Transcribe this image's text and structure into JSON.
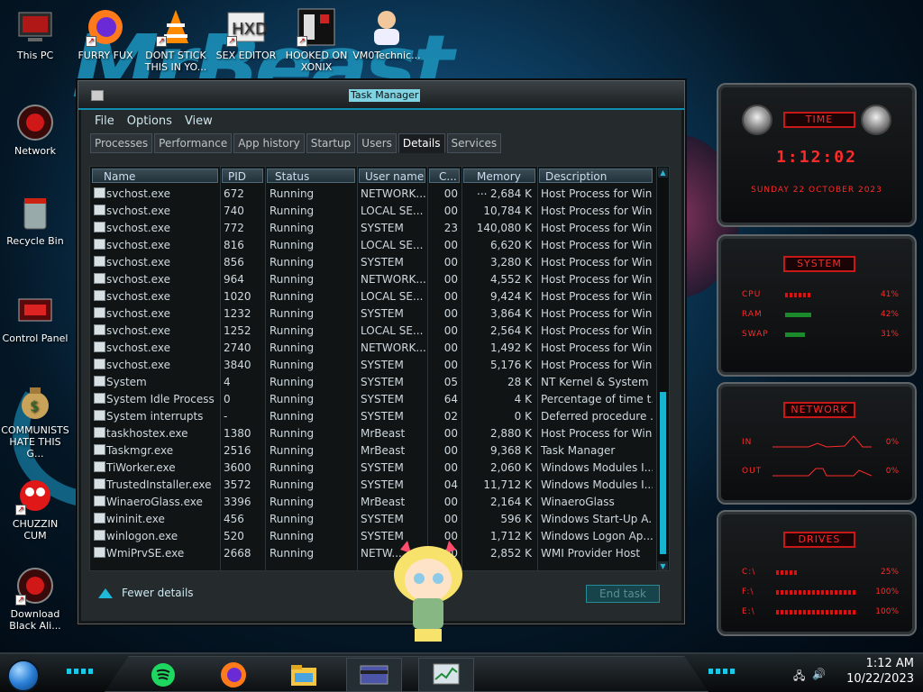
{
  "desktop": {
    "wallpaper_text": "MrBeast",
    "icons": [
      {
        "label": "This PC",
        "icon": "computer-icon"
      },
      {
        "label": "FURRY FUX",
        "icon": "firefox-icon"
      },
      {
        "label": "DONT STICK THIS IN YO...",
        "icon": "vlc-icon"
      },
      {
        "label": "SEX EDITOR",
        "icon": "hxd-icon"
      },
      {
        "label": "HOOKED ON XONIX",
        "icon": "xonix-icon"
      },
      {
        "label": "VM0Technic...",
        "icon": "doctor-icon"
      },
      {
        "label": "Network",
        "icon": "network-icon"
      },
      {
        "label": "Recycle Bin",
        "icon": "recycle-bin-icon"
      },
      {
        "label": "Control Panel",
        "icon": "control-panel-icon"
      },
      {
        "label": "COMMUNISTS HATE THIS G...",
        "icon": "money-bag-icon"
      },
      {
        "label": "CHUZZIN CUM",
        "icon": "chuzzle-icon"
      },
      {
        "label": "Download Black Ali...",
        "icon": "alien-icon"
      }
    ]
  },
  "taskmanager": {
    "title": "Task Manager",
    "menu": [
      "File",
      "Options",
      "View"
    ],
    "tabs": [
      "Processes",
      "Performance",
      "App history",
      "Startup",
      "Users",
      "Details",
      "Services"
    ],
    "active_tab": "Details",
    "columns": [
      "Name",
      "PID",
      "Status",
      "User name",
      "C...",
      "Memory ...",
      "Description"
    ],
    "rows": [
      {
        "name": "svchost.exe",
        "pid": "672",
        "status": "Running",
        "user": "NETWORK...",
        "cpu": "00",
        "mem": "2,684 K",
        "desc": "Host Process for Win..."
      },
      {
        "name": "svchost.exe",
        "pid": "740",
        "status": "Running",
        "user": "LOCAL SE...",
        "cpu": "00",
        "mem": "10,784 K",
        "desc": "Host Process for Win..."
      },
      {
        "name": "svchost.exe",
        "pid": "772",
        "status": "Running",
        "user": "SYSTEM",
        "cpu": "23",
        "mem": "140,080 K",
        "desc": "Host Process for Win..."
      },
      {
        "name": "svchost.exe",
        "pid": "816",
        "status": "Running",
        "user": "LOCAL SE...",
        "cpu": "00",
        "mem": "6,620 K",
        "desc": "Host Process for Win..."
      },
      {
        "name": "svchost.exe",
        "pid": "856",
        "status": "Running",
        "user": "SYSTEM",
        "cpu": "00",
        "mem": "3,280 K",
        "desc": "Host Process for Win..."
      },
      {
        "name": "svchost.exe",
        "pid": "964",
        "status": "Running",
        "user": "NETWORK...",
        "cpu": "00",
        "mem": "4,552 K",
        "desc": "Host Process for Win..."
      },
      {
        "name": "svchost.exe",
        "pid": "1020",
        "status": "Running",
        "user": "LOCAL SE...",
        "cpu": "00",
        "mem": "9,424 K",
        "desc": "Host Process for Win..."
      },
      {
        "name": "svchost.exe",
        "pid": "1232",
        "status": "Running",
        "user": "SYSTEM",
        "cpu": "00",
        "mem": "3,864 K",
        "desc": "Host Process for Win..."
      },
      {
        "name": "svchost.exe",
        "pid": "1252",
        "status": "Running",
        "user": "LOCAL SE...",
        "cpu": "00",
        "mem": "2,564 K",
        "desc": "Host Process for Win..."
      },
      {
        "name": "svchost.exe",
        "pid": "2740",
        "status": "Running",
        "user": "NETWORK...",
        "cpu": "00",
        "mem": "1,492 K",
        "desc": "Host Process for Win..."
      },
      {
        "name": "svchost.exe",
        "pid": "3840",
        "status": "Running",
        "user": "SYSTEM",
        "cpu": "00",
        "mem": "5,176 K",
        "desc": "Host Process for Win..."
      },
      {
        "name": "System",
        "pid": "4",
        "status": "Running",
        "user": "SYSTEM",
        "cpu": "05",
        "mem": "28 K",
        "desc": "NT Kernel & System"
      },
      {
        "name": "System Idle Process",
        "pid": "0",
        "status": "Running",
        "user": "SYSTEM",
        "cpu": "64",
        "mem": "4 K",
        "desc": "Percentage of time t..."
      },
      {
        "name": "System interrupts",
        "pid": "-",
        "status": "Running",
        "user": "SYSTEM",
        "cpu": "02",
        "mem": "0 K",
        "desc": "Deferred procedure ..."
      },
      {
        "name": "taskhostex.exe",
        "pid": "1380",
        "status": "Running",
        "user": "MrBeast",
        "cpu": "00",
        "mem": "2,880 K",
        "desc": "Host Process for Win..."
      },
      {
        "name": "Taskmgr.exe",
        "pid": "2516",
        "status": "Running",
        "user": "MrBeast",
        "cpu": "00",
        "mem": "9,368 K",
        "desc": "Task Manager"
      },
      {
        "name": "TiWorker.exe",
        "pid": "3600",
        "status": "Running",
        "user": "SYSTEM",
        "cpu": "00",
        "mem": "2,060 K",
        "desc": "Windows Modules I..."
      },
      {
        "name": "TrustedInstaller.exe",
        "pid": "3572",
        "status": "Running",
        "user": "SYSTEM",
        "cpu": "04",
        "mem": "11,712 K",
        "desc": "Windows Modules I..."
      },
      {
        "name": "WinaeroGlass.exe",
        "pid": "3396",
        "status": "Running",
        "user": "MrBeast",
        "cpu": "00",
        "mem": "2,164 K",
        "desc": "WinaeroGlass"
      },
      {
        "name": "wininit.exe",
        "pid": "456",
        "status": "Running",
        "user": "SYSTEM",
        "cpu": "00",
        "mem": "596 K",
        "desc": "Windows Start-Up A..."
      },
      {
        "name": "winlogon.exe",
        "pid": "520",
        "status": "Running",
        "user": "SYSTEM",
        "cpu": "00",
        "mem": "1,712 K",
        "desc": "Windows Logon Ap..."
      },
      {
        "name": "WmiPrvSE.exe",
        "pid": "2668",
        "status": "Running",
        "user": "NETW...",
        "cpu": "00",
        "mem": "2,852 K",
        "desc": "WMI Provider Host"
      }
    ],
    "fewer_details": "Fewer details",
    "end_task": "End task"
  },
  "widgets": {
    "time": {
      "header": "TIME",
      "clock": "1:12:02",
      "date": "SUNDAY 22 OCTOBER 2023"
    },
    "system": {
      "header": "SYSTEM",
      "cpu_label": "CPU",
      "cpu_val": "41%",
      "cpu_level": 0.41,
      "ram_label": "RAM",
      "ram_val": "42%",
      "ram_level": 0.42,
      "swap_label": "SWAP",
      "swap_val": "31%",
      "swap_level": 0.31
    },
    "network": {
      "header": "NETWORK",
      "in_label": "IN",
      "in_val": "0%",
      "out_label": "OUT",
      "out_val": "0%"
    },
    "drives": {
      "header": "DRIVES",
      "c_label": "C:\\",
      "c_val": "25%",
      "c_level": 0.25,
      "f_label": "F:\\",
      "f_val": "100%",
      "f_level": 1.0,
      "e_label": "E:\\",
      "e_val": "100%",
      "e_level": 1.0
    }
  },
  "taskbar": {
    "apps": [
      "spotify-icon",
      "firefox-icon",
      "file-explorer-icon",
      "card-icon",
      "task-manager-icon"
    ],
    "time": "1:12 AM",
    "date": "10/22/2023"
  }
}
